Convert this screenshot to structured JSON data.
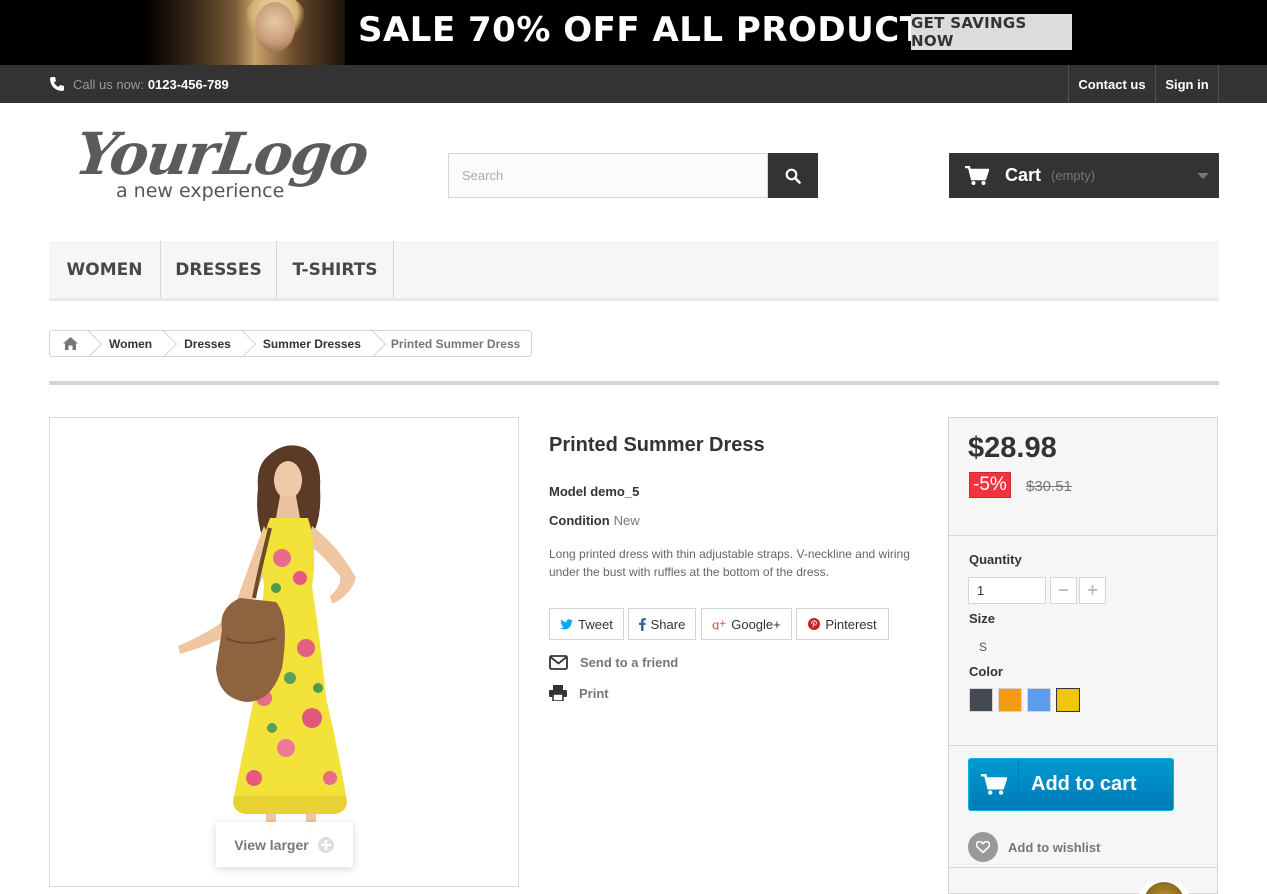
{
  "banner": {
    "title": "SALE 70% OFF ALL PRODUCTS",
    "cta": "GET SAVINGS NOW"
  },
  "topbar": {
    "call_label": "Call us now:",
    "phone": "0123-456-789",
    "contact": "Contact us",
    "signin": "Sign in"
  },
  "logo": {
    "main": "YourLogo",
    "sub": "a new experience"
  },
  "search": {
    "placeholder": "Search"
  },
  "cart": {
    "label": "Cart",
    "status": "(empty)"
  },
  "menu": {
    "items": [
      "WOMEN",
      "DRESSES",
      "T-SHIRTS"
    ]
  },
  "breadcrumb": {
    "items": [
      "Women",
      "Dresses",
      "Summer Dresses"
    ],
    "current": "Printed Summer Dress"
  },
  "product": {
    "view_larger": "View larger",
    "title": "Printed Summer Dress",
    "model_label": "Model",
    "model": "demo_5",
    "condition_label": "Condition",
    "condition": "New",
    "description": "Long printed dress with thin adjustable straps. V-neckline and wiring under the bust with ruffles at the bottom of the dress.",
    "social": {
      "tweet": "Tweet",
      "share": "Share",
      "google": "Google+",
      "pinterest": "Pinterest"
    },
    "send_friend": "Send to a friend",
    "print": "Print"
  },
  "buy": {
    "price": "$28.98",
    "reduction": "-5%",
    "old_price": "$30.51",
    "quantity_label": "Quantity",
    "quantity_value": "1",
    "size_label": "Size",
    "size_value": "S",
    "color_label": "Color",
    "colors": [
      "#434a54",
      "#f39c11",
      "#5d9cec",
      "#f1c40f"
    ],
    "selected_color": "#f1c40f",
    "add_to_cart": "Add to cart",
    "wishlist": "Add to wishlist"
  }
}
